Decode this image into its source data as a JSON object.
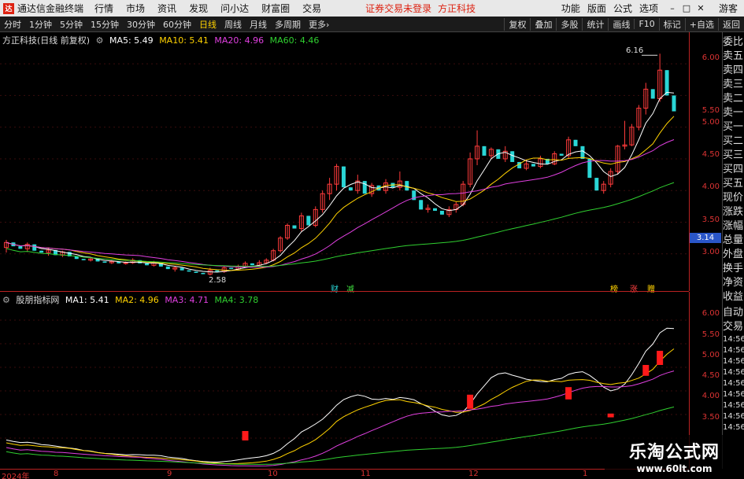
{
  "app": {
    "title": "通达信金融终端",
    "menus": [
      "行情",
      "市场",
      "资讯",
      "发现",
      "问小达",
      "财富圈",
      "交易"
    ],
    "warning": "证券交易未登录",
    "stock_title": "方正科技",
    "right_menus": [
      "功能",
      "版面",
      "公式",
      "选项"
    ],
    "guest": "游客"
  },
  "periods": {
    "items": [
      "分时",
      "1分钟",
      "5分钟",
      "15分钟",
      "30分钟",
      "60分钟",
      "日线",
      "周线",
      "月线",
      "多周期",
      "更多"
    ],
    "active": "日线",
    "tools": [
      "复权",
      "叠加",
      "多股",
      "统计",
      "画线",
      "F10",
      "标记",
      "+自选",
      "返回"
    ]
  },
  "main_legend": {
    "name": "方正科技(日线 前复权)",
    "ma5": "MA5: 5.49",
    "ma10": "MA10: 5.41",
    "ma20": "MA20: 4.96",
    "ma60": "MA60: 4.46",
    "colors": {
      "ma5": "#ffffff",
      "ma10": "#ffd200",
      "ma20": "#e040e0",
      "ma60": "#30d030"
    }
  },
  "sub_legend": {
    "name": "股朋指标网",
    "ma1": "MA1: 5.41",
    "ma2": "MA2: 4.96",
    "ma3": "MA3: 4.71",
    "ma4": "MA4: 3.78",
    "colors": {
      "ma1": "#ffffff",
      "ma2": "#ffd200",
      "ma3": "#e040e0",
      "ma4": "#30d030"
    }
  },
  "main_axis": {
    "ticks": [
      "6.00",
      "5.50",
      "5.00",
      "4.50",
      "4.00",
      "3.50",
      "3.00"
    ],
    "current_price": "3.14"
  },
  "sub_axis": {
    "ticks": [
      "6.00",
      "5.50",
      "5.00",
      "4.50",
      "4.00",
      "3.50"
    ]
  },
  "x_axis": {
    "ticks": [
      "2024年",
      "8",
      "9",
      "10",
      "11",
      "12",
      "1"
    ]
  },
  "annotations": {
    "high": "6.16",
    "low": "2.58",
    "tag_cai": "财",
    "tag_jian": "减",
    "tag_bang": "榜",
    "tag_zhang": "涨",
    "tag_zeng": "赠"
  },
  "right_panel": {
    "header": "委比",
    "items": [
      "卖五",
      "卖四",
      "卖三",
      "卖二",
      "卖一",
      "买一",
      "买二",
      "买三",
      "买四",
      "买五",
      "现价",
      "涨跌",
      "涨幅",
      "总量",
      "外盘",
      "换手",
      "净资",
      "收益"
    ],
    "sub_header1": "自动",
    "sub_header2": "交易",
    "times": [
      "14:56",
      "14:56",
      "14:56",
      "14:56",
      "14:56",
      "14:56",
      "14:56",
      "14:56",
      "14:56"
    ]
  },
  "watermark": {
    "line1": "乐淘公式网",
    "line2": "www.60lt.com"
  },
  "chart_data": {
    "type": "candlestick",
    "price_range": [
      2.55,
      6.25
    ],
    "sub_range": [
      2.9,
      6.3
    ],
    "candles": [
      [
        3.1,
        3.18,
        3.05,
        3.02,
        3.22
      ],
      [
        3.18,
        3.12,
        3.05,
        3.25,
        3.1
      ],
      [
        3.12,
        3.08,
        3.02,
        3.15,
        3.05
      ],
      [
        3.08,
        3.15,
        3.05,
        3.03,
        3.18
      ],
      [
        3.15,
        3.05,
        3.02,
        3.18,
        3.0
      ],
      [
        3.05,
        3.02,
        2.98,
        3.08,
        2.98
      ],
      [
        3.02,
        3.06,
        2.98,
        2.97,
        3.1
      ],
      [
        3.06,
        2.98,
        2.96,
        3.08,
        2.95
      ],
      [
        2.98,
        3.03,
        2.96,
        2.95,
        3.05
      ],
      [
        3.03,
        2.96,
        2.94,
        3.05,
        2.93
      ],
      [
        2.96,
        2.92,
        2.88,
        2.98,
        2.88
      ],
      [
        2.92,
        2.9,
        2.88,
        2.94,
        2.87
      ],
      [
        2.9,
        2.92,
        2.87,
        2.88,
        2.94
      ],
      [
        2.92,
        2.88,
        2.85,
        2.94,
        2.85
      ],
      [
        2.88,
        2.86,
        2.84,
        2.9,
        2.83
      ],
      [
        2.86,
        2.88,
        2.84,
        2.84,
        2.9
      ],
      [
        2.88,
        2.85,
        2.83,
        2.9,
        2.83
      ],
      [
        2.85,
        2.86,
        2.82,
        2.83,
        2.88
      ],
      [
        2.86,
        2.9,
        2.84,
        2.84,
        2.93
      ],
      [
        2.9,
        2.85,
        2.83,
        2.92,
        2.82
      ],
      [
        2.85,
        2.82,
        2.8,
        2.87,
        2.79
      ],
      [
        2.82,
        2.86,
        2.8,
        2.8,
        2.89
      ],
      [
        2.86,
        2.8,
        2.78,
        2.88,
        2.77
      ],
      [
        2.8,
        2.76,
        2.74,
        2.82,
        2.73
      ],
      [
        2.76,
        2.78,
        2.72,
        2.72,
        2.8
      ],
      [
        2.78,
        2.74,
        2.7,
        2.8,
        2.7
      ],
      [
        2.74,
        2.72,
        2.68,
        2.76,
        2.67
      ],
      [
        2.72,
        2.7,
        2.66,
        2.74,
        2.64
      ],
      [
        2.7,
        2.68,
        2.6,
        2.72,
        2.58
      ],
      [
        2.68,
        2.74,
        2.66,
        2.66,
        2.78
      ],
      [
        2.74,
        2.72,
        2.68,
        2.76,
        2.68
      ],
      [
        2.72,
        2.78,
        2.7,
        2.7,
        2.8
      ],
      [
        2.78,
        2.76,
        2.72,
        2.8,
        2.72
      ],
      [
        2.76,
        2.8,
        2.74,
        2.74,
        2.83
      ],
      [
        2.8,
        2.85,
        2.78,
        2.78,
        2.88
      ],
      [
        2.85,
        2.82,
        2.8,
        2.88,
        2.8
      ],
      [
        2.82,
        2.86,
        2.8,
        2.8,
        2.9
      ],
      [
        2.86,
        2.9,
        2.84,
        2.84,
        2.93
      ],
      [
        2.9,
        3.05,
        2.88,
        2.88,
        3.08
      ],
      [
        3.05,
        3.25,
        3.02,
        3.02,
        3.28
      ],
      [
        3.25,
        3.45,
        3.22,
        3.22,
        3.48
      ],
      [
        3.45,
        3.4,
        3.3,
        3.5,
        3.28
      ],
      [
        3.4,
        3.6,
        3.35,
        3.35,
        3.65
      ],
      [
        3.6,
        3.45,
        3.4,
        3.65,
        3.38
      ],
      [
        3.45,
        3.7,
        3.42,
        3.42,
        3.75
      ],
      [
        3.7,
        3.95,
        3.65,
        3.65,
        4.0
      ],
      [
        3.95,
        4.1,
        3.85,
        3.85,
        4.2
      ],
      [
        4.1,
        4.38,
        4.0,
        4.0,
        4.42
      ],
      [
        4.38,
        4.05,
        3.95,
        4.4,
        3.9
      ],
      [
        4.05,
        4.0,
        3.92,
        4.1,
        3.88
      ],
      [
        4.0,
        4.15,
        3.95,
        3.95,
        4.25
      ],
      [
        4.15,
        3.95,
        3.9,
        4.2,
        3.85
      ],
      [
        3.95,
        4.08,
        3.9,
        3.9,
        4.12
      ],
      [
        4.08,
        4.0,
        3.95,
        4.12,
        3.92
      ],
      [
        4.0,
        4.12,
        3.95,
        3.95,
        4.18
      ],
      [
        4.12,
        4.05,
        4.0,
        4.18,
        3.98
      ],
      [
        4.05,
        4.15,
        4.0,
        4.0,
        4.3
      ],
      [
        4.15,
        4.0,
        3.92,
        4.2,
        3.88
      ],
      [
        4.0,
        3.85,
        3.78,
        4.05,
        3.75
      ],
      [
        3.85,
        3.7,
        3.65,
        3.9,
        3.62
      ],
      [
        3.7,
        3.72,
        3.65,
        3.65,
        3.78
      ],
      [
        3.72,
        3.68,
        3.62,
        3.75,
        3.6
      ],
      [
        3.68,
        3.62,
        3.55,
        3.7,
        3.52
      ],
      [
        3.62,
        3.7,
        3.58,
        3.58,
        3.75
      ],
      [
        3.7,
        3.78,
        3.65,
        3.65,
        3.82
      ],
      [
        3.78,
        4.1,
        3.75,
        3.75,
        4.15
      ],
      [
        4.1,
        4.5,
        4.05,
        4.05,
        4.6
      ],
      [
        4.5,
        4.7,
        4.4,
        4.4,
        4.95
      ],
      [
        4.7,
        4.55,
        4.45,
        4.75,
        4.4
      ],
      [
        4.55,
        4.65,
        4.5,
        4.5,
        4.68
      ],
      [
        4.65,
        4.5,
        4.45,
        4.7,
        4.42
      ],
      [
        4.5,
        4.62,
        4.45,
        4.45,
        4.7
      ],
      [
        4.62,
        4.45,
        4.4,
        4.65,
        4.38
      ],
      [
        4.45,
        4.35,
        4.3,
        4.5,
        4.28
      ],
      [
        4.35,
        4.42,
        4.32,
        4.32,
        4.48
      ],
      [
        4.42,
        4.38,
        4.33,
        4.45,
        4.3
      ],
      [
        4.38,
        4.5,
        4.35,
        4.35,
        4.55
      ],
      [
        4.5,
        4.42,
        4.38,
        4.55,
        4.35
      ],
      [
        4.42,
        4.58,
        4.4,
        4.4,
        4.62
      ],
      [
        4.58,
        4.55,
        4.5,
        4.65,
        4.48
      ],
      [
        4.55,
        4.8,
        4.5,
        4.5,
        4.85
      ],
      [
        4.8,
        4.7,
        4.6,
        4.85,
        4.55
      ],
      [
        4.7,
        4.5,
        4.4,
        4.75,
        4.35
      ],
      [
        4.5,
        4.2,
        4.1,
        4.55,
        4.05
      ],
      [
        4.2,
        4.0,
        3.95,
        4.25,
        3.92
      ],
      [
        4.0,
        4.1,
        3.95,
        3.95,
        4.15
      ],
      [
        4.1,
        4.3,
        4.05,
        4.05,
        4.35
      ],
      [
        4.3,
        4.7,
        4.25,
        4.25,
        4.72
      ],
      [
        4.7,
        4.72,
        4.65,
        4.65,
        5.1
      ],
      [
        4.72,
        5.0,
        4.7,
        4.7,
        5.05
      ],
      [
        5.0,
        5.3,
        4.95,
        4.95,
        5.35
      ],
      [
        5.3,
        5.6,
        5.2,
        5.2,
        5.7
      ],
      [
        5.6,
        5.45,
        5.35,
        5.65,
        5.3
      ],
      [
        5.45,
        5.9,
        5.4,
        5.4,
        6.16
      ],
      [
        5.9,
        5.5,
        5.4,
        5.95,
        5.35
      ],
      [
        5.5,
        5.25,
        5.15,
        5.55,
        5.1
      ]
    ],
    "signal_bars": [
      [
        34,
        3.65,
        3.45
      ],
      [
        66,
        4.42,
        4.12
      ],
      [
        80,
        4.58,
        4.32
      ],
      [
        86,
        4.02,
        3.94
      ],
      [
        91,
        5.05,
        4.82
      ],
      [
        93,
        5.35,
        5.05
      ]
    ]
  }
}
